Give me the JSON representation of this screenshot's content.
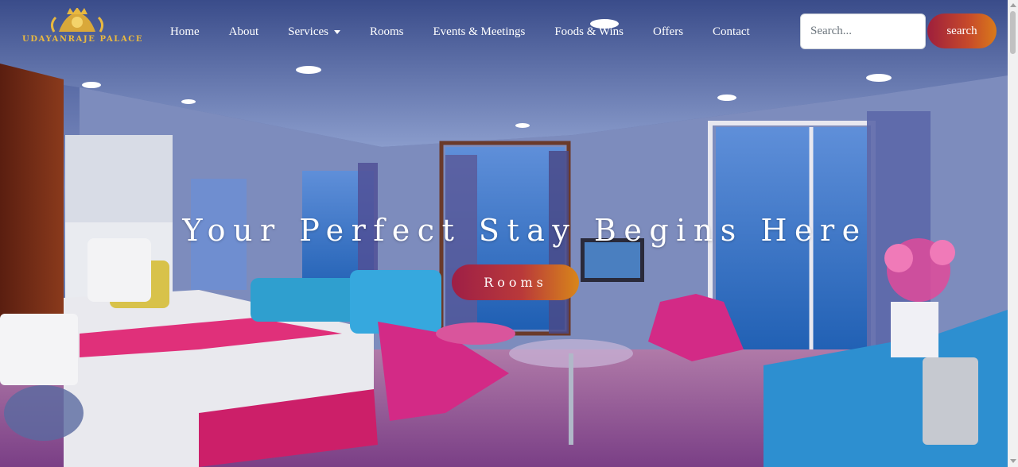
{
  "brand": {
    "name": "UDAYANRAJE PALACE",
    "logo_icon": "crown-crest-icon",
    "accent_color": "#e8b840"
  },
  "nav": {
    "items": [
      {
        "label": "Home"
      },
      {
        "label": "About"
      },
      {
        "label": "Services",
        "dropdown": true
      },
      {
        "label": "Rooms"
      },
      {
        "label": "Events & Meetings"
      },
      {
        "label": "Foods & Wins"
      },
      {
        "label": "Offers"
      },
      {
        "label": "Contact"
      }
    ]
  },
  "search": {
    "placeholder": "Search...",
    "value": "",
    "button_label": "search"
  },
  "hero": {
    "title": "Your Perfect Stay Begins Here",
    "cta_label": "Rooms",
    "background": "luxury-cruise-cabin-photo"
  },
  "colors": {
    "button_gradient_start": "#9e1f46",
    "button_gradient_end": "#d8861a"
  }
}
